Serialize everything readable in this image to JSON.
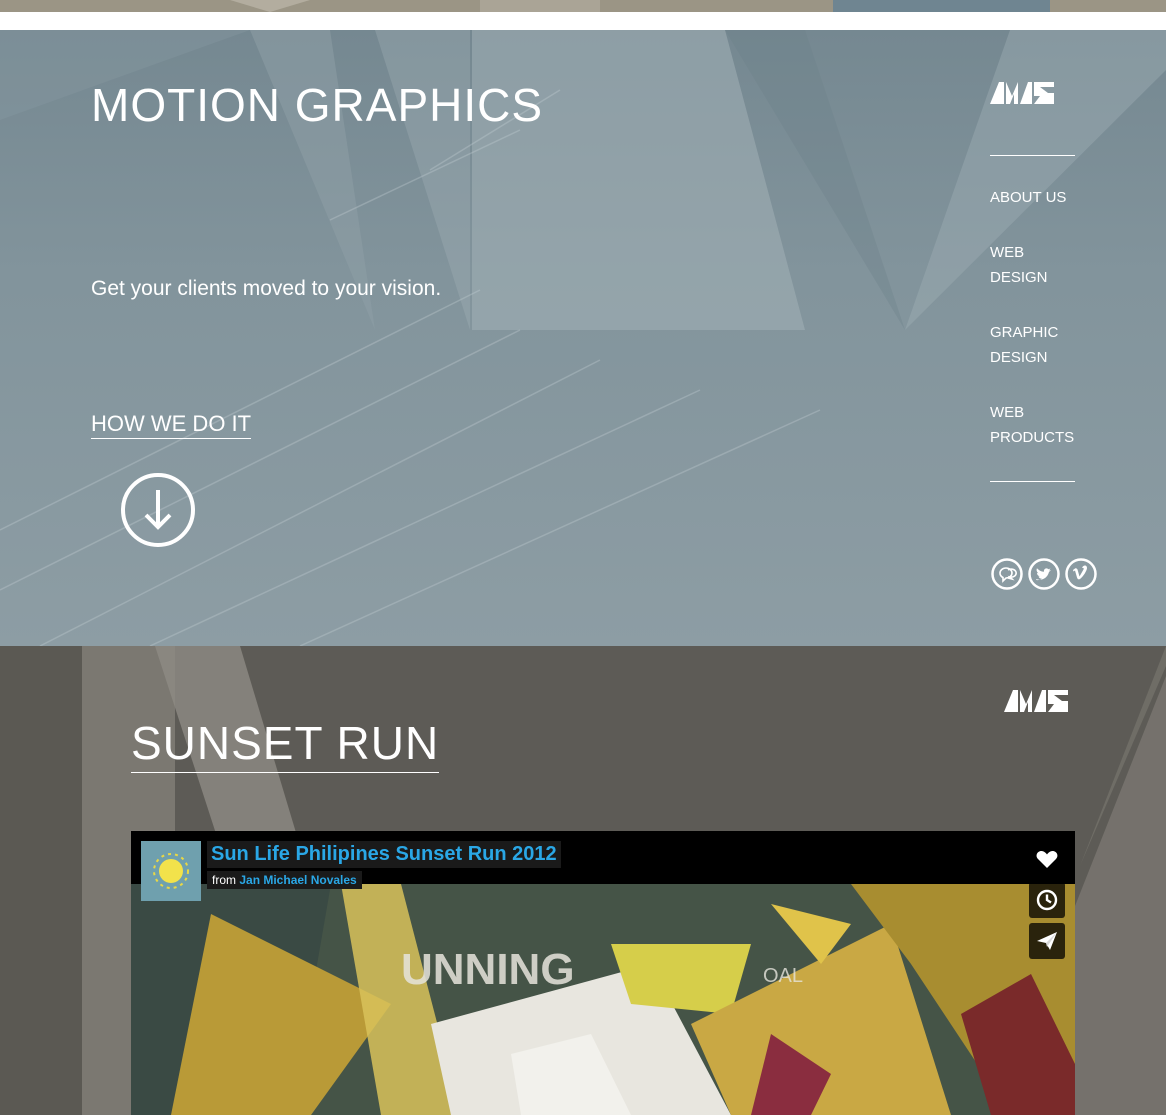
{
  "hero": {
    "title": "MOTION GRAPHICS",
    "tagline": "Get your clients moved to your vision.",
    "link_label": "HOW WE DO IT"
  },
  "nav": {
    "items": [
      {
        "label": "ABOUT US"
      },
      {
        "label": "WEB\nDESIGN"
      },
      {
        "label": "GRAPHIC\nDESIGN"
      },
      {
        "label": "WEB\nPRODUCTS"
      }
    ]
  },
  "social": {
    "icons": [
      "chat-icon",
      "twitter-icon",
      "vimeo-icon"
    ]
  },
  "section": {
    "title": "SUNSET RUN"
  },
  "video": {
    "title": "Sun Life Philipines Sunset Run 2012",
    "from_prefix": "from",
    "author": "Jan Michael Novales",
    "frame_text": "UNNING",
    "frame_text_small": "OAL"
  },
  "colors": {
    "hero_bg": "#82949c",
    "section_bg": "#5d5b56",
    "link_blue": "#2aa7e6"
  }
}
